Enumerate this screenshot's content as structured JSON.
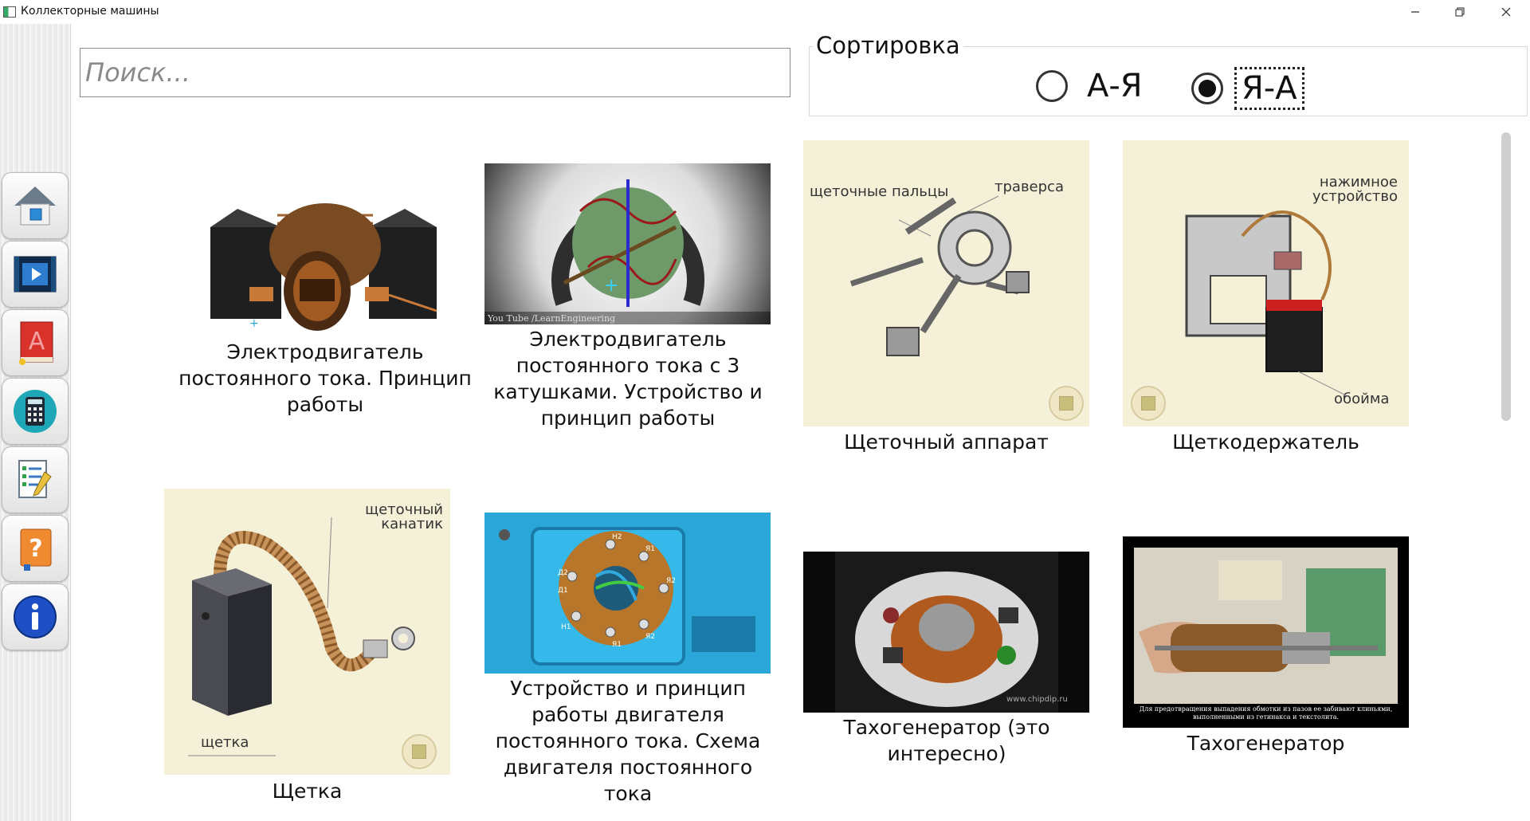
{
  "window": {
    "title": "Коллекторные машины"
  },
  "search": {
    "placeholder": "Поиск..."
  },
  "sort": {
    "legend": "Сортировка",
    "options": [
      {
        "label": "А-Я",
        "selected": false
      },
      {
        "label": "Я-А",
        "selected": true
      }
    ]
  },
  "sidebar": {
    "items": [
      {
        "icon": "home-icon"
      },
      {
        "icon": "video-icon"
      },
      {
        "icon": "dictionary-book-icon"
      },
      {
        "icon": "calculator-icon"
      },
      {
        "icon": "checklist-test-icon"
      },
      {
        "icon": "help-book-icon"
      },
      {
        "icon": "info-icon"
      }
    ]
  },
  "cards": [
    {
      "caption": "Электродвигатель постоянного тока. Принцип работы",
      "type": "3d-model"
    },
    {
      "caption": "Электродвигатель постоянного тока с 3 катушками. Устройство и принцип работы",
      "type": "video",
      "watermark": "You Tube /LearnEngineering"
    },
    {
      "caption": "Щеточный аппарат",
      "type": "illustration",
      "labels": [
        "щеточные пальцы",
        "траверса"
      ]
    },
    {
      "caption": "Щеткодержатель",
      "type": "illustration",
      "labels": [
        "нажимное устройство",
        "обойма"
      ]
    },
    {
      "caption": "Щетка",
      "type": "illustration",
      "labels": [
        "щеточный канатик",
        "щетка"
      ]
    },
    {
      "caption": "Устройство и принцип работы двигателя постоянного тока. Схема двигателя постоянного тока",
      "type": "video",
      "terminals": [
        "Н2",
        "Я1",
        "Я2",
        "Н1",
        "Я1",
        "Я2",
        "Д2",
        "Д1"
      ]
    },
    {
      "caption": "Тахогенератор (это интересно)",
      "type": "video",
      "watermark": "www.chipdip.ru"
    },
    {
      "caption": "Тахогенератор",
      "type": "video",
      "subtitle": "Для предотвращения выпадения обмотки из пазов ее забивают клиньями, выполненными из гетинакса и текстолита."
    }
  ],
  "colors": {
    "cream": "#f5f0d8",
    "blue": "#2aa7d8",
    "copper": "#b86a2c"
  }
}
